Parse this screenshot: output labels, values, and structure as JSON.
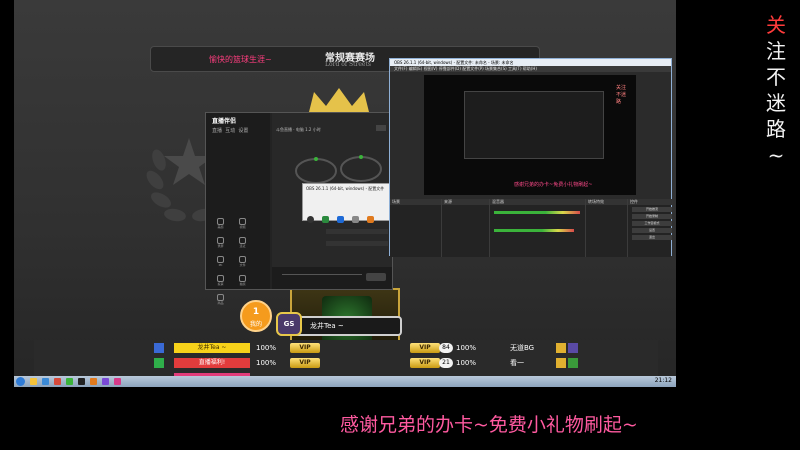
{
  "game": {
    "tagline": "愉快的篮球生涯~",
    "title": "常规赛赛场",
    "subtitle": "Lord of Streets",
    "rank": {
      "number": "1",
      "label": "我的"
    },
    "player_badge": "GS",
    "player_name": "龙井Tea ~"
  },
  "scoreboard": {
    "rows": [
      {
        "name": "龙井Tea ~",
        "name_color": "#f7d21a",
        "pct1": "100%",
        "vip1": "VIP",
        "vip2": "VIP",
        "vip2_num": "84",
        "pct2": "100%",
        "right_name": "无道BG"
      },
      {
        "name": "直播福利!",
        "name_color": "#e23c3c",
        "pct1": "100%",
        "vip1": "VIP",
        "vip2": "VIP",
        "vip2_num": "21",
        "pct2": "100%",
        "right_name": "看一"
      }
    ]
  },
  "streamer_app": {
    "logo": "直播伴侣",
    "header": "斗鱼直播 · 电脑 1.2 小时",
    "dialog_title": "OBS 26.1.1 (64-bit, windows) - 配置文件",
    "tabs": [
      "直播",
      "互动",
      "设置"
    ],
    "tools": [
      "美颜",
      "视频",
      "录屏",
      "连麦",
      "PK",
      "文件",
      "投票",
      "抽奖",
      "商品"
    ]
  },
  "obs": {
    "window_title": "OBS 26.1.1 (64-bit, windows) - 配置文件: 未命名 - 场景: 未命名",
    "menu": "文件(F)  编辑(E)  视图(V)  停靠部件(D)  配置文件(P)  场景集合(S)  工具(T)  帮助(H)",
    "preview_caption": "感谢兄弟的办卡~免费小礼物刷起~",
    "preview_side": "关注不迷路",
    "docks": [
      "场景",
      "来源",
      "混音器",
      "转场特效",
      "控件"
    ],
    "controls": [
      "开始推流",
      "开始录制",
      "工作室模式",
      "设置",
      "退出"
    ]
  },
  "taskbar": {
    "clock": "21:12"
  },
  "overlay": {
    "vertical_text": [
      "关",
      "注",
      "不",
      "迷",
      "路",
      "~"
    ],
    "caption": "感谢兄弟的办卡~免费小礼物刷起~"
  }
}
